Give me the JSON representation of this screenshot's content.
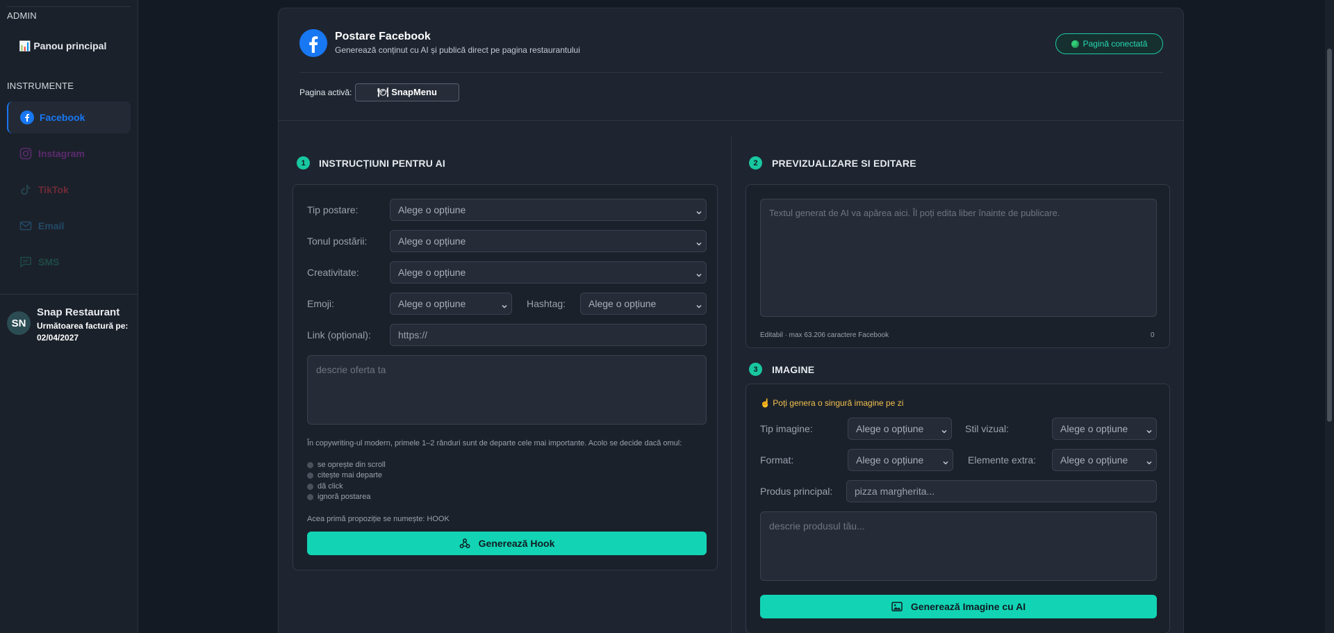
{
  "sidebar": {
    "admin_section": "ADMIN",
    "dashboard_label": "📊 Panou principal",
    "tools_section": "INSTRUMENTE",
    "items": [
      {
        "label": "Facebook",
        "color": "#1877f2"
      },
      {
        "label": "Instagram",
        "color": "#5b2a6e"
      },
      {
        "label": "TikTok",
        "color": "#6e2a35"
      },
      {
        "label": "Email",
        "color": "#234a66"
      },
      {
        "label": "SMS",
        "color": "#1e4b45"
      }
    ],
    "account": {
      "initials": "SN",
      "name": "Snap Restaurant",
      "invoice_label": "Următoarea factură pe:",
      "invoice_date": "02/04/2027"
    }
  },
  "header": {
    "title": "Postare Facebook",
    "subtitle": "Generează conținut cu AI și publică direct pe pagina restaurantului",
    "connected_badge": "Pagină conectată",
    "active_page_label": "Pagina activă:",
    "active_page_value": "🍽 SnapMenu"
  },
  "instructions": {
    "step": "1",
    "title": "INSTRUCȚIUNI PENTRU AI",
    "post_type_label": "Tip postare:",
    "post_type_value": "Alege o opțiune",
    "tone_label": "Tonul postării:",
    "tone_value": "Alege o opțiune",
    "creativity_label": "Creativitate:",
    "creativity_value": "Alege o opțiune",
    "emoji_label": "Emoji:",
    "emoji_value": "Alege o opțiune",
    "hashtag_label": "Hashtag:",
    "hashtag_value": "Alege o opțiune",
    "link_label": "Link (opțional):",
    "link_placeholder": "https://",
    "offer_placeholder": "descrie oferta ta",
    "hint": "În copywriting-ul modern, primele 1–2 rânduri sunt de departe cele mai importante. Acolo se decide dacă omul:",
    "bullets": [
      "se oprește din scroll",
      "citește mai departe",
      "dă click",
      "ignoră postarea"
    ],
    "hook_note": "Acea primă propoziție se numește: HOOK",
    "generate_hook": "Generează Hook"
  },
  "preview": {
    "step": "2",
    "title": "PREVIZUALIZARE SI EDITARE",
    "placeholder": "Textul generat de AI va apărea aici. Îl poți edita liber înainte de publicare.",
    "limit_note": "Editabil · max 63.206 caractere Facebook",
    "char_count": "0"
  },
  "image": {
    "step": "3",
    "title": "IMAGINE",
    "notice": "☝️ Poți genera o singură imagine pe zi",
    "image_type_label": "Tip imagine:",
    "image_type_value": "Alege o opțiune",
    "visual_style_label": "Stil vizual:",
    "visual_style_value": "Alege o opțiune",
    "format_label": "Format:",
    "format_value": "Alege o opțiune",
    "extra_label": "Elemente extra:",
    "extra_value": "Alege o opțiune",
    "main_product_label": "Produs principal:",
    "main_product_placeholder": "pizza margherita...",
    "product_desc_placeholder": "descrie produsul tău...",
    "generate_image": "Generează Imagine cu AI"
  },
  "colors": {
    "accent": "#12d4b4",
    "facebook": "#1877f2",
    "notice": "#f2c14e"
  }
}
